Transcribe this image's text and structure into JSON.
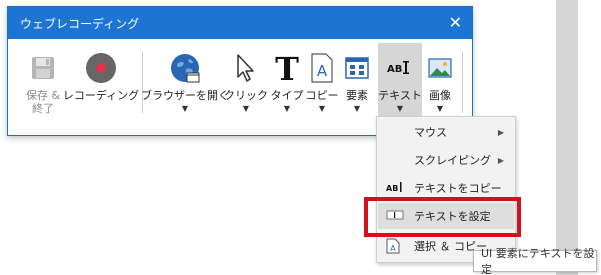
{
  "window": {
    "title": "ウェブレコーディング",
    "close_icon": "close-icon",
    "accent_color": "#1e74d2"
  },
  "toolbar": {
    "save_label": "保存 &\n終了",
    "recording_label": "レコーディング",
    "open_browser_label": "ブラウザーを開く",
    "click_label": "クリック",
    "type_label": "タイプ",
    "copy_label": "コピー",
    "element_label": "要素",
    "text_label": "テキスト",
    "image_label": "画像"
  },
  "menu": {
    "items": [
      {
        "label": "マウス",
        "has_submenu": true
      },
      {
        "label": "スクレイピング",
        "has_submenu": true
      },
      {
        "label": "テキストをコピー",
        "icon": "abi-text-icon"
      },
      {
        "label": "テキストを設定",
        "icon": "set-text-icon"
      },
      {
        "label": "選択 ＆ コピー",
        "icon": "select-copy-icon"
      }
    ]
  },
  "tooltip": {
    "text": "UI 要素にテキストを設定"
  },
  "highlight_color": "#d4111b"
}
